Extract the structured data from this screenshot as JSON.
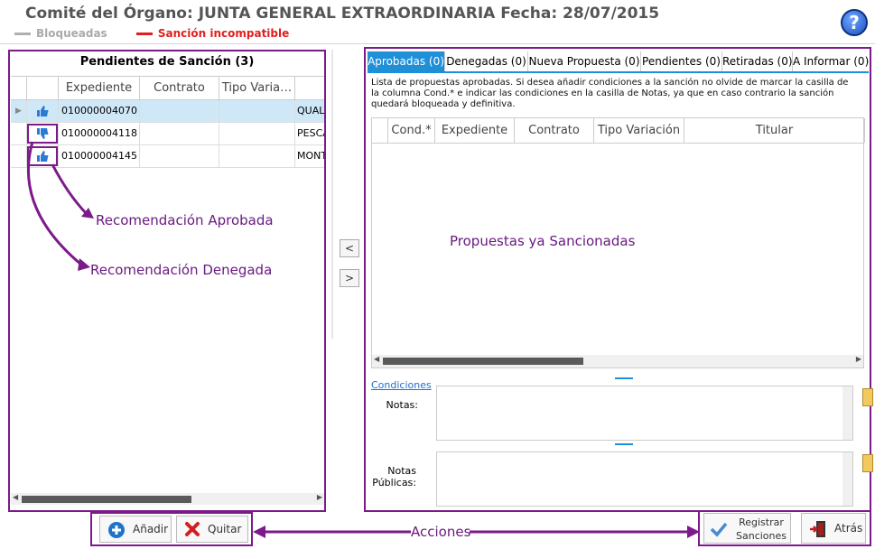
{
  "header": {
    "title": "Comité del Órgano: JUNTA GENERAL EXTRAORDINARIA   Fecha: 28/07/2015",
    "legend": [
      {
        "label": "Bloqueadas",
        "color": "#b0b0b0"
      },
      {
        "label": "Sanción incompatible",
        "color": "#e02020"
      }
    ],
    "help_icon": "question-icon"
  },
  "left_panel": {
    "title": "Pendientes de Sanción (3)",
    "columns": [
      "",
      "",
      "Expediente",
      "Contrato",
      "Tipo Varia…",
      ""
    ],
    "rows": [
      {
        "icon": "thumbs-up-icon",
        "expediente": "010000004070",
        "contrato": "",
        "tipo": "",
        "titular": "QUAL"
      },
      {
        "icon": "thumbs-down-icon",
        "expediente": "010000004118",
        "contrato": "",
        "tipo": "",
        "titular": "PESCA"
      },
      {
        "icon": "thumbs-up-icon",
        "expediente": "010000004145",
        "contrato": "",
        "tipo": "",
        "titular": "MONT"
      }
    ]
  },
  "move_buttons": {
    "left": "<",
    "right": ">"
  },
  "right_panel": {
    "tabs": [
      "Aprobadas (0)",
      "Denegadas (0)",
      "Nueva Propuesta (0)",
      "Pendientes (0)",
      "Retiradas (0)",
      "A Informar (0)"
    ],
    "info": "Lista de propuestas aprobadas. Si desea añadir condiciones a la sanción no olvide de marcar la casilla de la columna Cond.* e indicar las condiciones en la casilla de Notas, ya que en caso contrario la sanción quedará bloqueada y definitiva.",
    "columns": [
      "Cond.*",
      "Expediente",
      "Contrato",
      "Tipo Variación",
      "Titular"
    ],
    "condiciones_link": "Condiciones",
    "notas_label": "Notas:",
    "notas_publicas_label": "Notas Públicas:"
  },
  "callouts": {
    "aprobada": "Recomendación Aprobada",
    "denegada": "Recomendación Denegada",
    "sancionadas": "Propuestas ya Sancionadas",
    "acciones": "Acciones"
  },
  "actions": {
    "add": "Añadir",
    "remove": "Quitar",
    "register": "Registrar Sanciones",
    "back": "Atrás"
  },
  "colors": {
    "accent": "#1f8fd8",
    "annotation": "#7c1a8a"
  }
}
